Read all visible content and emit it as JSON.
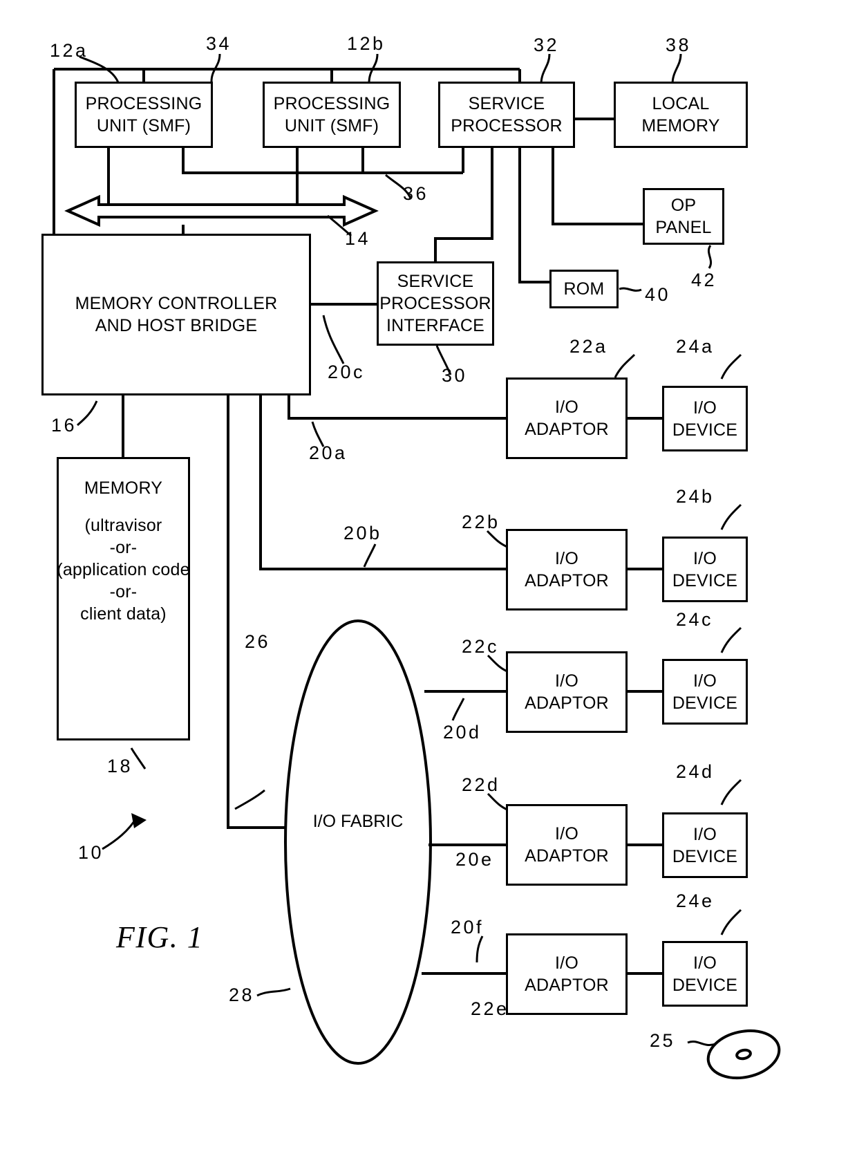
{
  "figure": {
    "label": "FIG. 1",
    "title_ref": "10"
  },
  "boxes": {
    "processing_unit_a": {
      "lines": [
        "PROCESSING",
        "UNIT (SMF)"
      ],
      "ref": "12a"
    },
    "processing_unit_b": {
      "lines": [
        "PROCESSING",
        "UNIT (SMF)"
      ],
      "ref": "12b"
    },
    "service_processor": {
      "lines": [
        "SERVICE",
        "PROCESSOR"
      ],
      "ref": "32"
    },
    "local_memory": {
      "lines": [
        "LOCAL",
        "MEMORY"
      ],
      "ref": "38"
    },
    "op_panel": {
      "lines": [
        "OP",
        "PANEL"
      ],
      "ref": "42"
    },
    "rom": {
      "lines": [
        "ROM"
      ],
      "ref": "40"
    },
    "memory_controller": {
      "lines": [
        "MEMORY CONTROLLER",
        "AND HOST BRIDGE"
      ],
      "ref": "16"
    },
    "service_processor_interface": {
      "lines": [
        "SERVICE",
        "PROCESSOR",
        "INTERFACE"
      ],
      "ref": "30"
    },
    "memory": {
      "lines": [
        "MEMORY",
        "",
        "(ultravisor",
        "-or-",
        "(application code",
        "-or-",
        "client data)"
      ],
      "title": "MEMORY",
      "detail": [
        "(ultravisor",
        "-or-",
        "(application code",
        "-or-",
        "client data)"
      ],
      "ref": "18"
    },
    "io_fabric": {
      "lines": [
        "I/O",
        "FABRIC"
      ],
      "ref": "28"
    }
  },
  "io_rows": [
    {
      "adaptor": {
        "lines": [
          "I/O",
          "ADAPTOR"
        ],
        "ref": "22a"
      },
      "device": {
        "lines": [
          "I/O",
          "DEVICE"
        ],
        "ref": "24a"
      },
      "link_ref": "20a"
    },
    {
      "adaptor": {
        "lines": [
          "I/O",
          "ADAPTOR"
        ],
        "ref": "22b"
      },
      "device": {
        "lines": [
          "I/O",
          "DEVICE"
        ],
        "ref": "24b"
      },
      "link_ref": "20b"
    },
    {
      "adaptor": {
        "lines": [
          "I/O",
          "ADAPTOR"
        ],
        "ref": "22c"
      },
      "device": {
        "lines": [
          "I/O",
          "DEVICE"
        ],
        "ref": "24c"
      },
      "link_ref": "20d"
    },
    {
      "adaptor": {
        "lines": [
          "I/O",
          "ADAPTOR"
        ],
        "ref": "22d"
      },
      "device": {
        "lines": [
          "I/O",
          "DEVICE"
        ],
        "ref": "24d"
      },
      "link_ref": "20e"
    },
    {
      "adaptor": {
        "lines": [
          "I/O",
          "ADAPTOR"
        ],
        "ref": "22e"
      },
      "device": {
        "lines": [
          "I/O",
          "DEVICE"
        ],
        "ref": "24e"
      },
      "link_ref": "20f"
    }
  ],
  "refs": {
    "pu_a": "12a",
    "pu_b": "12b",
    "bus_top": "34",
    "service_processor": "32",
    "local_memory": "38",
    "pu_sp_link": "36",
    "system_bus": "14",
    "memory_controller": "16",
    "memory": "18",
    "rom": "40",
    "op_panel": "42",
    "sp_interface": "30",
    "link_20a": "20a",
    "link_20b": "20b",
    "link_20c": "20c",
    "link_20d": "20d",
    "link_20e": "20e",
    "link_20f": "20f",
    "fabric_link": "26",
    "fabric": "28",
    "adaptor_a": "22a",
    "adaptor_b": "22b",
    "adaptor_c": "22c",
    "adaptor_d": "22d",
    "adaptor_e": "22e",
    "device_a": "24a",
    "device_b": "24b",
    "device_c": "24c",
    "device_d": "24d",
    "device_e": "24e",
    "disk": "25",
    "system": "10"
  },
  "colors": {
    "line": "#000000",
    "background": "#ffffff"
  }
}
